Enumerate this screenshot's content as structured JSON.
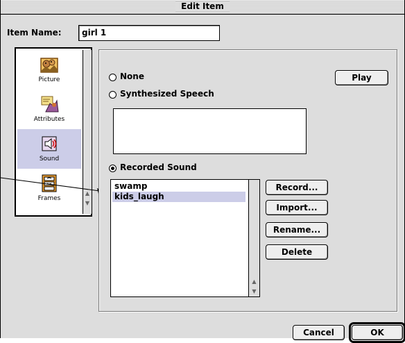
{
  "window": {
    "title": "Edit Item"
  },
  "item_name": {
    "label": "Item Name:",
    "value": "girl 1"
  },
  "sidebar": {
    "items": [
      {
        "label": "Picture",
        "icon": "picture-icon",
        "selected": false
      },
      {
        "label": "Attributes",
        "icon": "attributes-icon",
        "selected": false
      },
      {
        "label": "Sound",
        "icon": "speaker-icon",
        "selected": true
      },
      {
        "label": "Frames",
        "icon": "frames-icon",
        "selected": false
      }
    ]
  },
  "sound_panel": {
    "options": [
      {
        "label": "None",
        "checked": false
      },
      {
        "label": "Synthesized Speech",
        "checked": false
      },
      {
        "label": "Recorded Sound",
        "checked": true
      }
    ],
    "speech_text": "",
    "play_label": "Play",
    "recorded_sounds": [
      {
        "name": "swamp",
        "selected": false
      },
      {
        "name": "kids_laugh",
        "selected": true
      }
    ],
    "buttons": {
      "record": "Record...",
      "import": "Import...",
      "rename": "Rename...",
      "delete": "Delete"
    }
  },
  "footer": {
    "cancel": "Cancel",
    "ok": "OK"
  },
  "colors": {
    "selection": "#cccde8",
    "window_bg": "#dddddd"
  }
}
